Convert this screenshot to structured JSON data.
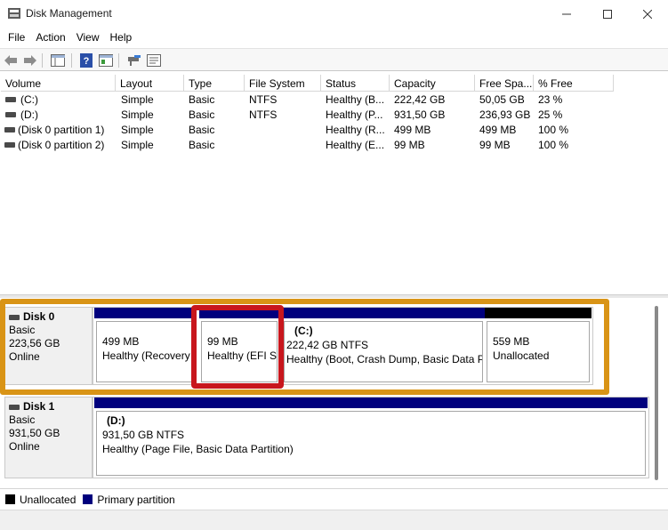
{
  "window": {
    "title": "Disk Management",
    "icon": "disk-management-icon"
  },
  "menu": [
    "File",
    "Action",
    "View",
    "Help"
  ],
  "toolbar": {
    "icons": [
      "back-arrow-icon",
      "forward-arrow-icon",
      "console-tree-icon",
      "help-icon",
      "action-pane-icon",
      "connect-icon",
      "properties-icon"
    ]
  },
  "volume_list": {
    "columns": [
      "Volume",
      "Layout",
      "Type",
      "File System",
      "Status",
      "Capacity",
      "Free Spa...",
      "% Free"
    ],
    "rows": [
      {
        "volume": "(C:)",
        "layout": "Simple",
        "type": "Basic",
        "fs": "NTFS",
        "status": "Healthy (B...",
        "capacity": "222,42 GB",
        "free": "50,05 GB",
        "pct": "23 %"
      },
      {
        "volume": "(D:)",
        "layout": "Simple",
        "type": "Basic",
        "fs": "NTFS",
        "status": "Healthy (P...",
        "capacity": "931,50 GB",
        "free": "236,93 GB",
        "pct": "25 %"
      },
      {
        "volume": "(Disk 0 partition 1)",
        "layout": "Simple",
        "type": "Basic",
        "fs": "",
        "status": "Healthy (R...",
        "capacity": "499 MB",
        "free": "499 MB",
        "pct": "100 %"
      },
      {
        "volume": "(Disk 0 partition 2)",
        "layout": "Simple",
        "type": "Basic",
        "fs": "",
        "status": "Healthy (E...",
        "capacity": "99 MB",
        "free": "99 MB",
        "pct": "100 %"
      }
    ]
  },
  "disks": [
    {
      "name": "Disk 0",
      "type": "Basic",
      "size": "223,56 GB",
      "state": "Online",
      "partitions": [
        {
          "title": "",
          "size": "499 MB",
          "status": "Healthy (Recovery P",
          "kind": "primary"
        },
        {
          "title": "",
          "size": "99 MB",
          "status": "Healthy (EFI S",
          "kind": "primary"
        },
        {
          "title": "(C:)",
          "size": "222,42 GB NTFS",
          "status": "Healthy (Boot, Crash Dump, Basic Data Pa",
          "kind": "primary"
        },
        {
          "title": "",
          "size": "559 MB",
          "status": "Unallocated",
          "kind": "unallocated"
        }
      ]
    },
    {
      "name": "Disk 1",
      "type": "Basic",
      "size": "931,50 GB",
      "state": "Online",
      "partitions": [
        {
          "title": "(D:)",
          "size": "931,50 GB NTFS",
          "status": "Healthy (Page File, Basic Data Partition)",
          "kind": "primary"
        }
      ]
    }
  ],
  "legend": [
    {
      "label": "Unallocated",
      "color": "#000000"
    },
    {
      "label": "Primary partition",
      "color": "#00007d"
    }
  ],
  "colors": {
    "primary": "#00007d",
    "unallocated": "#000000",
    "highlight_orange": "#d99416",
    "highlight_red": "#c8161d"
  }
}
